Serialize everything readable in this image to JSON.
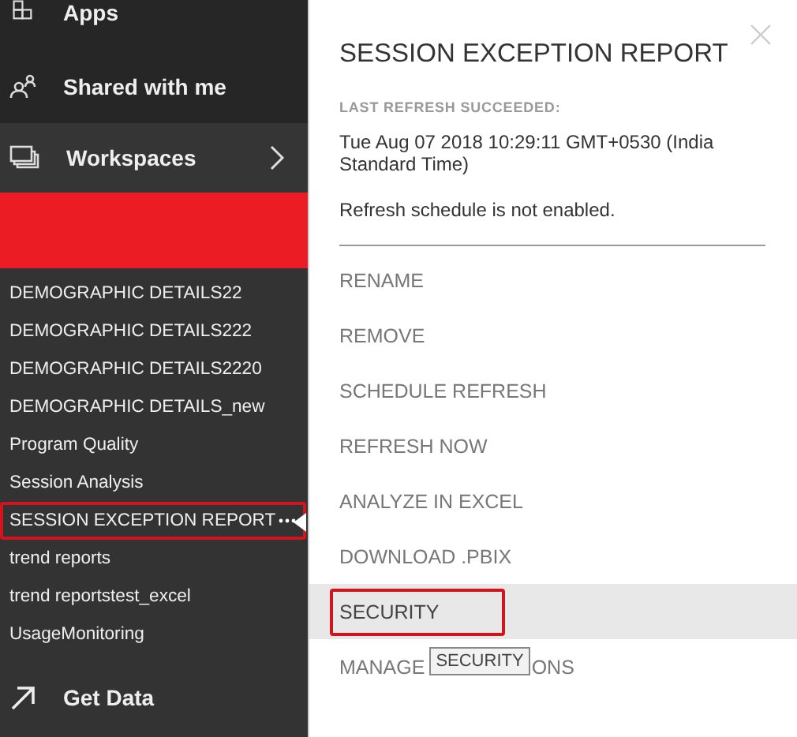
{
  "nav": [
    {
      "kind": "apps",
      "label": "Apps",
      "selected": false
    },
    {
      "kind": "shared",
      "label": "Shared with me",
      "selected": false
    },
    {
      "kind": "workspaces",
      "label": "Workspaces",
      "selected": true
    }
  ],
  "reports": [
    {
      "label": "DEMOGRAPHIC DETAILS22",
      "selected": false
    },
    {
      "label": "DEMOGRAPHIC DETAILS222",
      "selected": false
    },
    {
      "label": "DEMOGRAPHIC DETAILS2220",
      "selected": false
    },
    {
      "label": "DEMOGRAPHIC DETAILS_new",
      "selected": false
    },
    {
      "label": "Program Quality",
      "selected": false
    },
    {
      "label": "Session Analysis",
      "selected": false
    },
    {
      "label": "SESSION EXCEPTION REPORT",
      "selected": true
    },
    {
      "label": "trend reports",
      "selected": false
    },
    {
      "label": "trend reportstest_excel",
      "selected": false
    },
    {
      "label": "UsageMonitoring",
      "selected": false
    }
  ],
  "get_data": {
    "label": "Get Data"
  },
  "panel": {
    "title": "SESSION EXCEPTION REPORT",
    "refresh_label": "LAST REFRESH SUCCEEDED:",
    "refresh_time": "Tue Aug 07 2018 10:29:11 GMT+0530 (India Standard Time)",
    "schedule_note": "Refresh schedule is not enabled.",
    "menu": [
      {
        "label": "RENAME",
        "selected": false
      },
      {
        "label": "REMOVE",
        "selected": false
      },
      {
        "label": "SCHEDULE REFRESH",
        "selected": false
      },
      {
        "label": "REFRESH NOW",
        "selected": false
      },
      {
        "label": "ANALYZE IN EXCEL",
        "selected": false
      },
      {
        "label": "DOWNLOAD .PBIX",
        "selected": false
      },
      {
        "label": "SECURITY",
        "selected": true
      },
      {
        "label": "MANAGE",
        "label_end": "ONS",
        "selected": false
      }
    ],
    "tooltip": "SECURITY"
  }
}
